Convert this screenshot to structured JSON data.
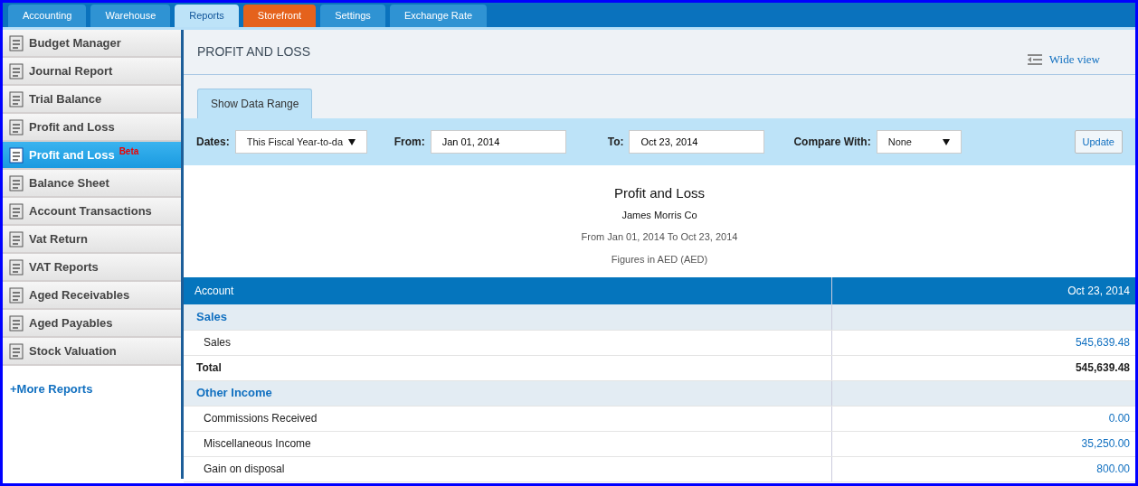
{
  "tabs": [
    {
      "label": "Accounting",
      "selected": false,
      "kind": "normal"
    },
    {
      "label": "Warehouse",
      "selected": false,
      "kind": "normal"
    },
    {
      "label": "Reports",
      "selected": true,
      "kind": "normal"
    },
    {
      "label": "Storefront",
      "selected": false,
      "kind": "highlight"
    },
    {
      "label": "Settings",
      "selected": false,
      "kind": "normal"
    },
    {
      "label": "Exchange Rate",
      "selected": false,
      "kind": "normal"
    }
  ],
  "sidebar": {
    "items": [
      {
        "label": "Budget Manager",
        "selected": false
      },
      {
        "label": "Journal Report",
        "selected": false
      },
      {
        "label": "Trial Balance",
        "selected": false
      },
      {
        "label": "Profit and Loss",
        "selected": false
      },
      {
        "label": "Profit and Loss",
        "badge": "Beta",
        "selected": true
      },
      {
        "label": "Balance Sheet",
        "selected": false
      },
      {
        "label": "Account Transactions",
        "selected": false
      },
      {
        "label": "Vat Return",
        "selected": false
      },
      {
        "label": "VAT Reports",
        "selected": false
      },
      {
        "label": "Aged Receivables",
        "selected": false
      },
      {
        "label": "Aged Payables",
        "selected": false
      },
      {
        "label": "Stock Valuation",
        "selected": false
      }
    ],
    "more_link": "+More Reports"
  },
  "page": {
    "title": "PROFIT AND LOSS",
    "wide_view": "Wide view",
    "range_tab": "Show Data Range",
    "filters": {
      "dates_label": "Dates:",
      "dates_value": "This Fiscal Year-to-da",
      "from_label": "From:",
      "from_value": "Jan 01, 2014",
      "to_label": "To:",
      "to_value": "Oct 23, 2014",
      "compare_label": "Compare With:",
      "compare_value": "None",
      "update": "Update"
    },
    "report": {
      "title": "Profit and Loss",
      "company": "James Morris Co",
      "period": "From Jan 01, 2014 To Oct 23, 2014",
      "currency": "Figures in AED (AED)"
    },
    "table": {
      "columns": [
        "Account",
        "Oct 23, 2014"
      ],
      "rows": [
        {
          "kind": "section",
          "label": "Sales"
        },
        {
          "kind": "line",
          "label": "Sales",
          "value": "545,639.48"
        },
        {
          "kind": "total",
          "label": "Total",
          "value": "545,639.48"
        },
        {
          "kind": "section",
          "label": "Other Income"
        },
        {
          "kind": "line",
          "label": "Commissions Received",
          "value": "0.00"
        },
        {
          "kind": "line",
          "label": "Miscellaneous Income",
          "value": "35,250.00"
        },
        {
          "kind": "line",
          "label": "Gain on disposal",
          "value": "800.00"
        }
      ]
    }
  }
}
